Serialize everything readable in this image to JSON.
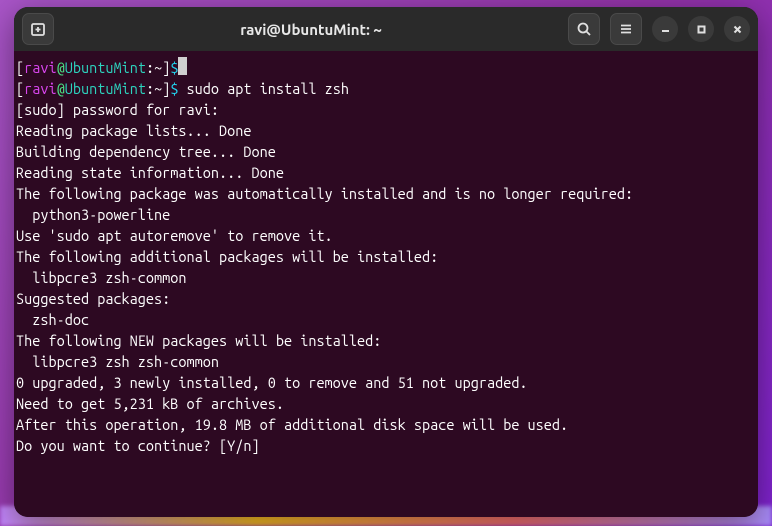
{
  "titlebar": {
    "title": "ravi@UbuntuMint: ~"
  },
  "prompt": {
    "user": "ravi",
    "at": "@",
    "host": "UbuntuMint",
    "colon": ":",
    "path": "~",
    "bracket_close": "]",
    "bracket_open": "[",
    "dollar": "$"
  },
  "commands": {
    "cmd1": "",
    "cmd2": " sudo apt install zsh"
  },
  "output": {
    "l1": "[sudo] password for ravi:",
    "l2": "Reading package lists... Done",
    "l3": "Building dependency tree... Done",
    "l4": "Reading state information... Done",
    "l5": "The following package was automatically installed and is no longer required:",
    "l6": "  python3-powerline",
    "l7": "Use 'sudo apt autoremove' to remove it.",
    "l8": "The following additional packages will be installed:",
    "l9": "  libpcre3 zsh-common",
    "l10": "Suggested packages:",
    "l11": "  zsh-doc",
    "l12": "The following NEW packages will be installed:",
    "l13": "  libpcre3 zsh zsh-common",
    "l14": "0 upgraded, 3 newly installed, 0 to remove and 51 not upgraded.",
    "l15": "Need to get 5,231 kB of archives.",
    "l16": "After this operation, 19.8 MB of additional disk space will be used.",
    "l17": "Do you want to continue? [Y/n] "
  }
}
